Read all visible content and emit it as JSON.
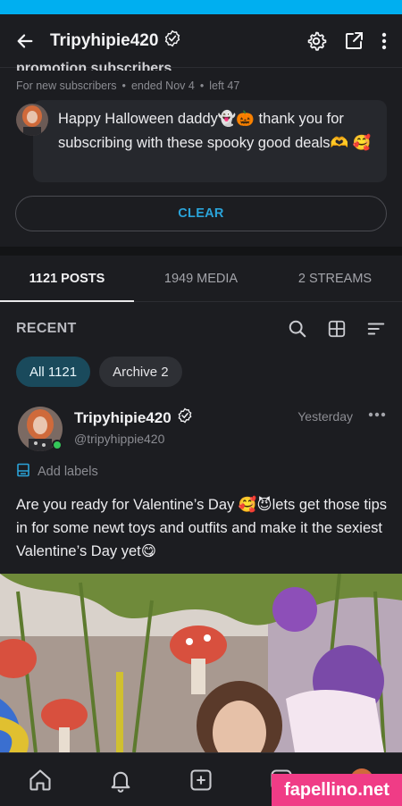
{
  "colors": {
    "accent": "#00aff0",
    "link": "#2aa3d9",
    "online": "#34c759",
    "chip_active": "#1a4a5c",
    "watermark": "#f03c86"
  },
  "topbar": {
    "title": "Tripyhipie420",
    "icons": [
      "back-arrow-icon",
      "verified-icon",
      "gear-icon",
      "share-icon",
      "kebab-menu-icon"
    ]
  },
  "promo": {
    "cut_title": "promotion subscribers",
    "meta_audience": "For new subscribers",
    "meta_ended": "ended Nov 4",
    "meta_left": "left 47",
    "message": "Happy Halloween daddy👻🎃 thank you for subscribing with these spooky good deals🫶 🥰",
    "clear_label": "CLEAR"
  },
  "tabs": [
    {
      "label": "1121 POSTS",
      "active": true
    },
    {
      "label": "1949 MEDIA",
      "active": false
    },
    {
      "label": "2 STREAMS",
      "active": false
    }
  ],
  "recent": {
    "label": "RECENT"
  },
  "chips": [
    {
      "label": "All 1121",
      "active": true
    },
    {
      "label": "Archive 2",
      "active": false
    }
  ],
  "post": {
    "author": "Tripyhipie420",
    "handle": "@tripyhippie420",
    "time": "Yesterday",
    "add_labels": "Add labels",
    "text": "Are you ready for Valentine’s Day 🥰😈lets get those tips in for some newt toys and outfits and make it the sexiest Valentine’s Day yet😋"
  },
  "bottom_nav": [
    "home-icon",
    "bell-icon",
    "plus-square-icon",
    "messages-icon",
    "profile-avatar"
  ],
  "watermark": "fapellino.net"
}
